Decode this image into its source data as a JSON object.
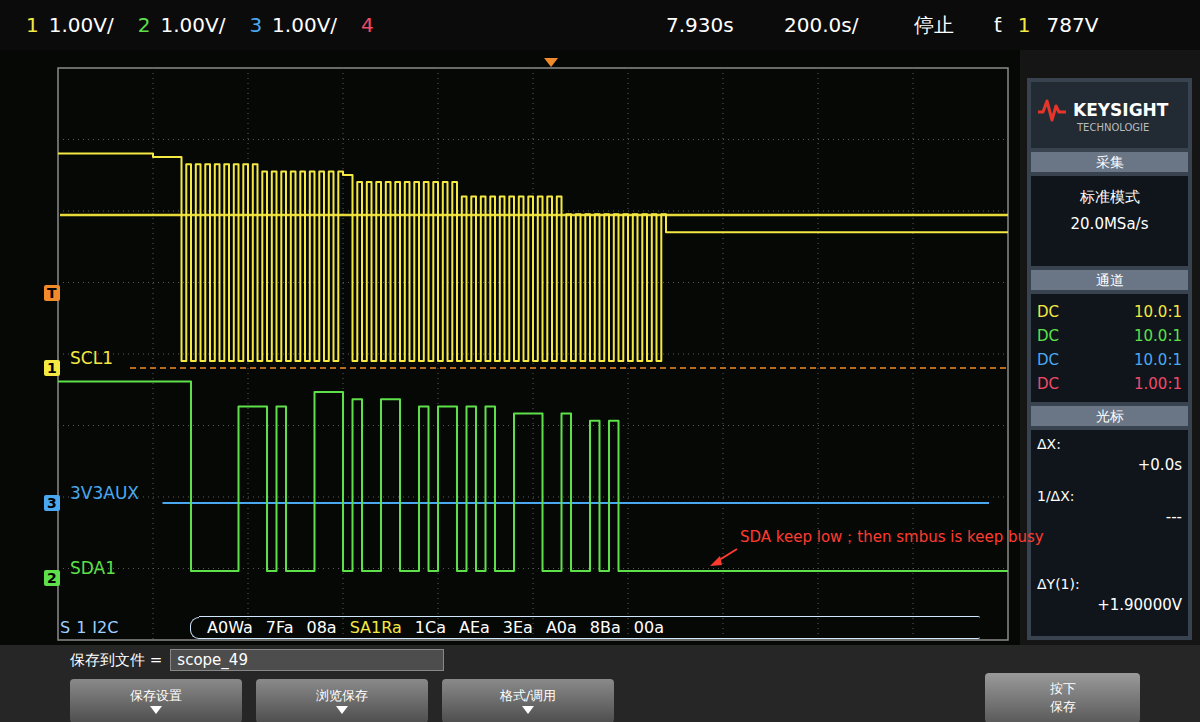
{
  "top_bar": {
    "channels": [
      {
        "number": "1",
        "scale": "1.00V/",
        "color": "#f4e842"
      },
      {
        "number": "2",
        "scale": "1.00V/",
        "color": "#5ee04a"
      },
      {
        "number": "3",
        "scale": "1.00V/",
        "color": "#4aa8f0"
      },
      {
        "number": "4",
        "color": "#f04a6a"
      }
    ],
    "delay": "7.930s",
    "timebase": "200.0s/",
    "run_state": "停止",
    "trigger_mode": "ƭ",
    "trigger_source": "1",
    "trigger_level": "787V"
  },
  "waveform": {
    "trigger": {
      "label": "T",
      "level": 1.05,
      "position": 5.19
    },
    "cursors": [
      {
        "level": 0,
        "kind": "dashed"
      },
      {
        "level": 2.14,
        "kind": "solid"
      }
    ],
    "series": [
      {
        "name": "SCL1",
        "channel": "1",
        "t0": 0,
        "step": 0.05,
        "values": [
          3,
          3,
          3,
          3,
          3,
          3,
          3,
          3,
          3,
          3,
          3,
          3,
          3,
          3,
          3,
          3,
          3,
          3,
          3,
          3,
          2.95,
          2.95,
          2.95,
          2.95,
          2.95,
          2.95,
          0.1,
          2.85,
          0.1,
          2.85,
          0.1,
          2.85,
          0.1,
          2.85,
          0.1,
          2.85,
          0.1,
          2.85,
          0.1,
          2.85,
          0.1,
          2.85,
          0.1,
          2.75,
          0.1,
          2.75,
          0.1,
          2.75,
          0.1,
          2.75,
          0.1,
          2.75,
          0.1,
          2.75,
          0.1,
          2.75,
          0.1,
          2.75,
          0.1,
          2.75,
          2.7,
          2.7,
          0.1,
          2.6,
          0.1,
          2.6,
          0.1,
          2.6,
          0.1,
          2.6,
          0.1,
          2.6,
          0.1,
          2.6,
          0.1,
          2.6,
          0.1,
          2.6,
          0.1,
          2.6,
          0.1,
          2.6,
          0.1,
          2.6,
          0.1,
          2.4,
          0.1,
          2.4,
          0.1,
          2.4,
          0.1,
          2.4,
          0.1,
          2.4,
          0.1,
          2.4,
          0.1,
          2.4,
          0.1,
          2.4,
          0.1,
          2.4,
          0.1,
          2.4,
          0.1,
          2.4,
          0.1,
          2.15,
          0.1,
          2.15,
          0.1,
          2.15,
          0.1,
          2.15,
          0.1,
          2.15,
          0.1,
          2.15,
          0.1,
          2.15,
          0.1,
          2.15,
          0.1,
          2.15,
          0.1,
          2.15,
          0.1,
          2.15,
          1.9,
          1.9,
          1.9,
          1.9,
          1.9,
          1.9,
          1.9,
          1.9,
          1.9,
          1.9,
          1.9,
          1.9,
          1.9,
          1.9,
          1.9,
          1.9,
          1.9,
          1.9,
          1.9,
          1.9,
          1.9,
          1.9,
          1.9,
          1.9,
          1.9,
          1.9,
          1.9,
          1.9,
          1.9,
          1.9,
          1.9,
          1.9,
          1.9,
          1.9,
          1.9,
          1.9,
          1.9,
          1.9,
          1.9,
          1.9,
          1.9,
          1.9,
          1.9,
          1.9,
          1.9,
          1.9,
          1.9,
          1.9,
          1.9,
          1.9,
          1.9,
          1.9,
          1.9,
          1.9,
          1.9,
          1.9,
          1.9,
          1.9,
          1.9,
          1.9,
          1.9,
          1.9,
          1.9,
          1.9,
          1.9,
          1.9,
          1.9,
          1.9,
          1.9,
          1.9,
          1.9,
          1.9
        ]
      },
      {
        "name": "3V3AUX",
        "channel": "3",
        "t0": 1.1,
        "step": 8.7,
        "values": [
          3.3
        ]
      },
      {
        "name": "SDA1",
        "channel": "2",
        "t0": 0,
        "step": 0.1,
        "values": [
          2.75,
          2.75,
          2.75,
          2.75,
          2.75,
          2.75,
          2.75,
          2.75,
          2.75,
          2.75,
          2.75,
          2.75,
          2.75,
          2.75,
          0.1,
          0.1,
          0.1,
          0.1,
          0.1,
          2.4,
          2.4,
          2.4,
          0.1,
          2.4,
          0.1,
          0.1,
          0.1,
          2.6,
          2.6,
          2.6,
          0.1,
          2.5,
          0.1,
          0.1,
          2.5,
          2.5,
          0.1,
          0.1,
          2.4,
          0.1,
          2.4,
          2.4,
          0.1,
          2.4,
          0.1,
          2.4,
          0.1,
          0.1,
          2.3,
          2.3,
          2.3,
          0.1,
          0.1,
          2.3,
          0.1,
          0.1,
          2.2,
          0.1,
          2.2,
          0.1,
          0.1,
          0.1,
          0.1,
          0.1,
          0.1,
          0.1,
          0.1,
          0.1,
          0.1,
          0.1,
          0.1,
          0.1,
          0.1,
          0.1,
          0.1,
          0.1,
          0.1,
          0.1,
          0.1,
          0.1,
          0.1,
          0.1,
          0.1,
          0.1,
          0.1,
          0.1,
          0.1,
          0.1,
          0.1,
          0.1,
          0.1,
          0.1,
          0.1,
          0.1,
          0.1,
          0.1,
          0.1,
          0.1,
          0.1,
          0.1
        ]
      }
    ]
  },
  "decode": {
    "prefix": "S",
    "index": "1",
    "protocol": "I2C",
    "frames": [
      {
        "text": "A0Wa",
        "color": "#ffffff"
      },
      {
        "text": "7Fa",
        "color": "#ffffff"
      },
      {
        "text": "08a",
        "color": "#ffffff"
      },
      {
        "text": "SA1Ra",
        "color": "#f4e842"
      },
      {
        "text": "1Ca",
        "color": "#ffffff"
      },
      {
        "text": "AEa",
        "color": "#ffffff"
      },
      {
        "text": "3Ea",
        "color": "#ffffff"
      },
      {
        "text": "A0a",
        "color": "#ffffff"
      },
      {
        "text": "8Ba",
        "color": "#ffffff"
      },
      {
        "text": "00a",
        "color": "#ffffff"
      }
    ]
  },
  "annotation": {
    "text": "SDA keep low；then smbus is keep busy"
  },
  "side_panel": {
    "brand": "KEYSIGHT",
    "brand_sub": "TECHNOLOGIE",
    "acquire": {
      "title": "采集",
      "mode": "标准模式",
      "rate": "20.0MSa/s"
    },
    "channels": {
      "title": "通道",
      "rows": [
        {
          "coupling": "DC",
          "probe": "10.0:1",
          "color": "#f4e842"
        },
        {
          "coupling": "DC",
          "probe": "10.0:1",
          "color": "#5ee04a"
        },
        {
          "coupling": "DC",
          "probe": "10.0:1",
          "color": "#4aa8f0"
        },
        {
          "coupling": "DC",
          "probe": "1.00:1",
          "color": "#f04a6a"
        }
      ]
    },
    "cursors": {
      "title": "光标",
      "dx_label": "ΔX:",
      "dx": "+0.0s",
      "inv_label": "1/ΔX:",
      "inv": "---",
      "dy_label": "ΔY(1):",
      "dy": "+1.90000V"
    }
  },
  "bottom_bar": {
    "save_label": "保存到文件 =",
    "file": "scope_49",
    "softkeys": [
      "保存设置",
      "浏览保存",
      "格式/调用"
    ],
    "right_key": [
      "按下",
      "保存"
    ]
  }
}
